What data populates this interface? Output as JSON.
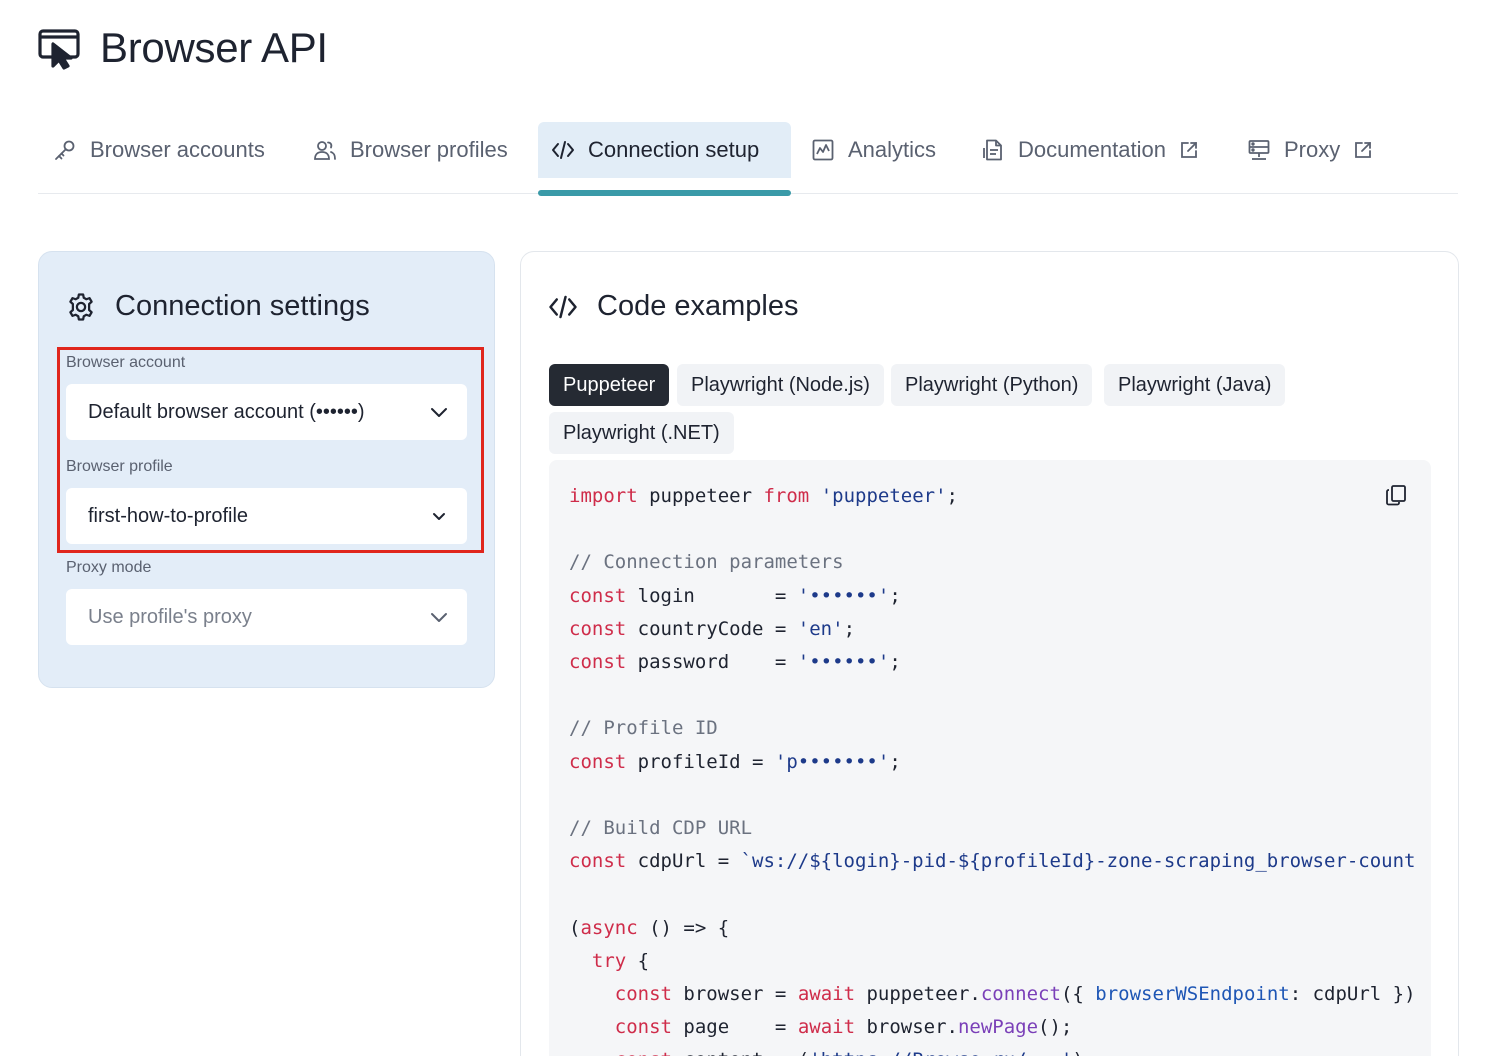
{
  "app": {
    "title": "Browser API",
    "logo_icon": "cursor-screen-icon"
  },
  "tabs": [
    {
      "label": "Browser accounts",
      "icon": "key-icon",
      "external": false,
      "active": false
    },
    {
      "label": "Browser profiles",
      "icon": "users-icon",
      "external": false,
      "active": false
    },
    {
      "label": "Connection setup",
      "icon": "code-icon",
      "external": false,
      "active": true
    },
    {
      "label": "Analytics",
      "icon": "chart-icon",
      "external": false,
      "active": false
    },
    {
      "label": "Documentation",
      "icon": "document-icon",
      "external": true,
      "active": false
    },
    {
      "label": "Proxy",
      "icon": "server-icon",
      "external": true,
      "active": false
    }
  ],
  "settings": {
    "title": "Connection settings",
    "browser_account": {
      "label": "Browser account",
      "value": "Default browser account (••••••)"
    },
    "browser_profile": {
      "label": "Browser profile",
      "value": "first-how-to-profile"
    },
    "proxy_mode": {
      "label": "Proxy mode",
      "value": "Use profile's proxy"
    }
  },
  "code": {
    "title": "Code examples",
    "languages": [
      {
        "label": "Puppeteer",
        "active": true
      },
      {
        "label": "Playwright (Node.js)",
        "active": false
      },
      {
        "label": "Playwright (Python)",
        "active": false
      },
      {
        "label": "Playwright (Java)",
        "active": false
      },
      {
        "label": "Playwright (.NET)",
        "active": false
      }
    ],
    "lines": [
      "import puppeteer from 'puppeteer';",
      "",
      "// Connection parameters",
      "const login       = '••••••';",
      "const countryCode = 'en';",
      "const password    = '••••••';",
      "",
      "// Profile ID",
      "const profileId = 'p•••••••';",
      "",
      "// Build CDP URL",
      "const cdpUrl = `ws://${login}-pid-${profileId}-zone-scraping_browser-count",
      "",
      "(async () => {",
      "  try {",
      "    const browser = await puppeteer.connect({ browserWSEndpoint: cdpUrl })",
      "    const page    = await browser.newPage();",
      "    const content = ('https://Browse.ru/...')"
    ]
  },
  "colors": {
    "accent": "#3a9aa8",
    "highlight": "#e0261d",
    "active_tab_bg": "#e2edf7"
  }
}
